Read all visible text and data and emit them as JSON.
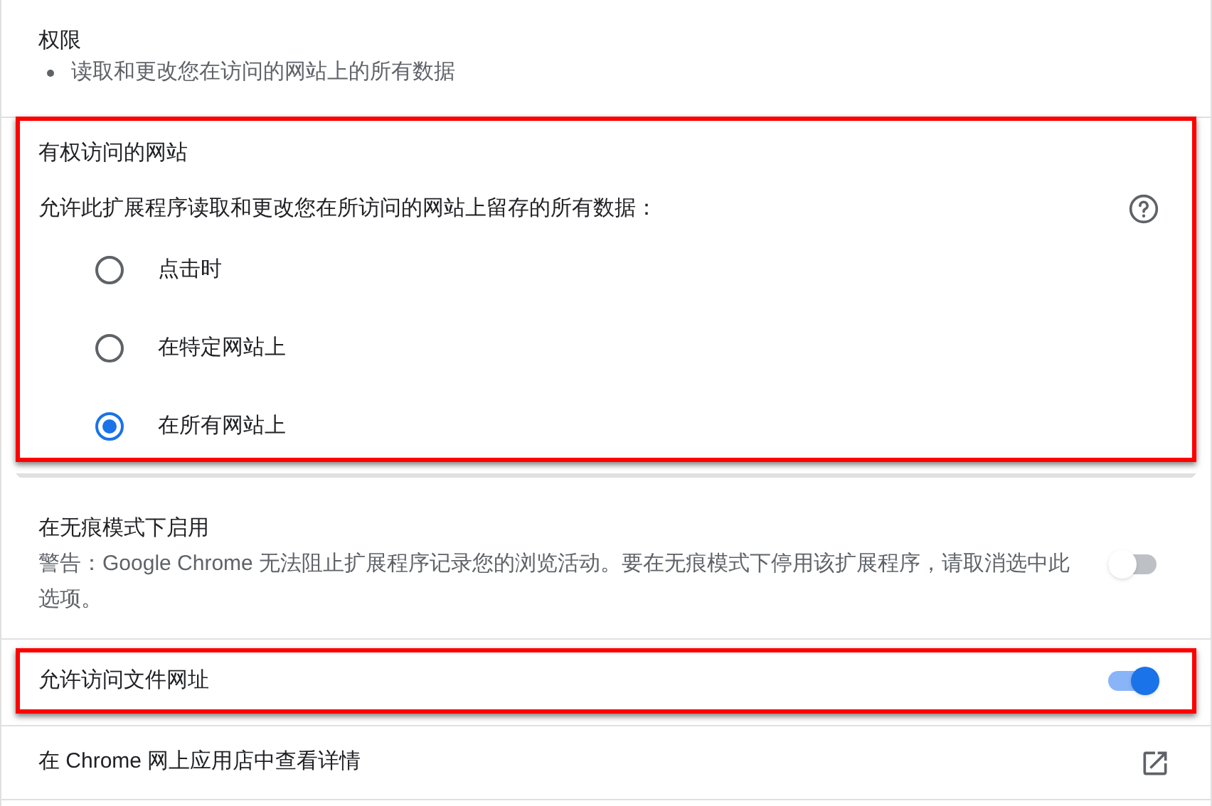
{
  "permissions": {
    "title": "权限",
    "items": [
      "读取和更改您在访问的网站上的所有数据"
    ]
  },
  "site_access": {
    "highlighted": true,
    "title": "有权访问的网站",
    "description": "允许此扩展程序读取和更改您在所访问的网站上留存的所有数据：",
    "options": [
      {
        "label": "点击时",
        "selected": false
      },
      {
        "label": "在特定网站上",
        "selected": false
      },
      {
        "label": "在所有网站上",
        "selected": true
      }
    ]
  },
  "incognito": {
    "title": "在无痕模式下启用",
    "warning": "警告：Google Chrome 无法阻止扩展程序记录您的浏览活动。要在无痕模式下停用该扩展程序，请取消选中此选项。",
    "on": false
  },
  "file_urls": {
    "highlighted": true,
    "label": "允许访问文件网址",
    "on": true
  },
  "web_store": {
    "label": "在 Chrome 网上应用店中查看详情"
  }
}
